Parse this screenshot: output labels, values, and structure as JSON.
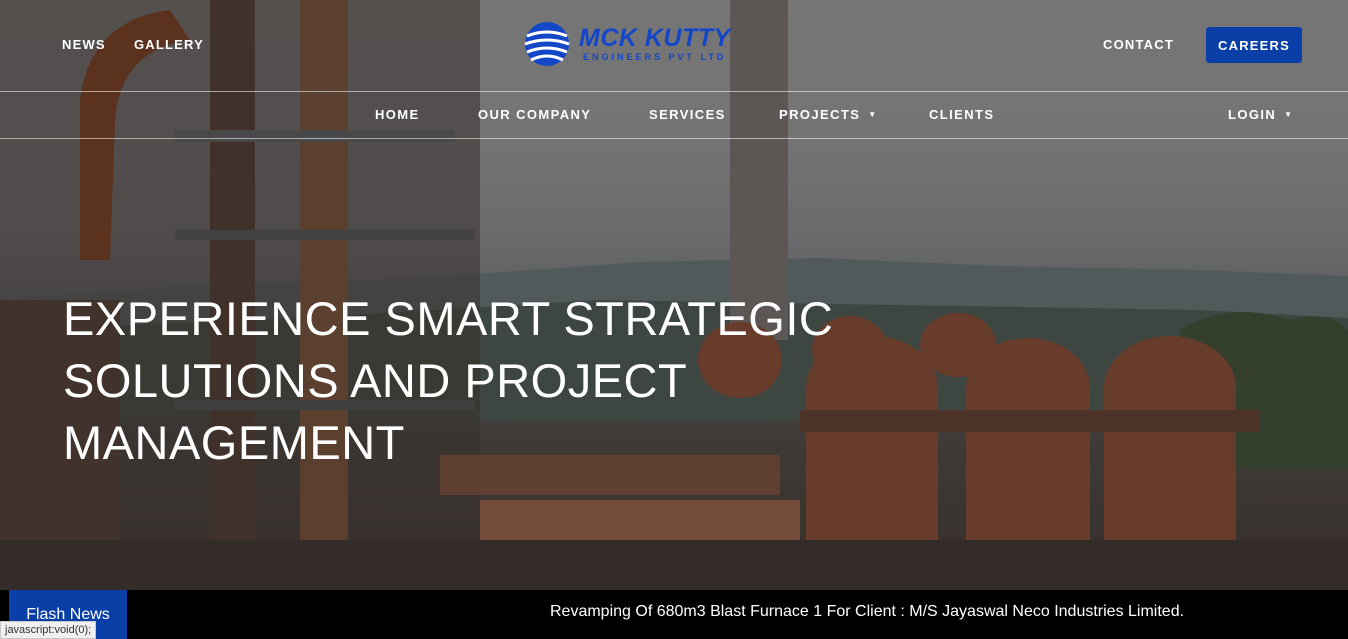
{
  "topbar": {
    "left_links": [
      "NEWS",
      "GALLERY"
    ],
    "contact_label": "CONTACT",
    "careers_label": "CAREERS"
  },
  "logo": {
    "title": "MCK KUTTY",
    "subtitle": "ENGINEERS PVT LTD"
  },
  "nav": {
    "items": [
      {
        "label": "HOME"
      },
      {
        "label": "OUR COMPANY"
      },
      {
        "label": "SERVICES"
      },
      {
        "label": "PROJECTS",
        "dropdown": true
      },
      {
        "label": "CLIENTS"
      }
    ],
    "login_label": "LOGIN"
  },
  "hero": {
    "headline_lines": [
      "EXPERIENCE SMART STRATEGIC",
      "SOLUTIONS AND PROJECT",
      "MANAGEMENT"
    ]
  },
  "news": {
    "label": "Flash News",
    "ticker": "Revamping Of 680m3 Blast Furnace 1 For Client : M/S Jayaswal Neco Industries Limited."
  },
  "browser_status": "javascript:void(0);",
  "colors": {
    "accent": "#0a3fa8",
    "logo": "#1446c8",
    "news_bg": "#000000"
  }
}
